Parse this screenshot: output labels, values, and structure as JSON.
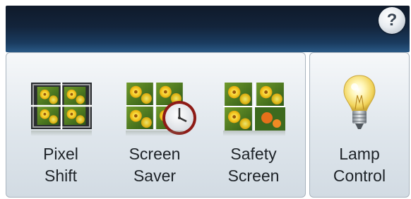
{
  "header": {
    "help_label": "?"
  },
  "items": [
    {
      "line1": "Pixel",
      "line2": "Shift",
      "icon": "pixel-shift-icon"
    },
    {
      "line1": "Screen",
      "line2": "Saver",
      "icon": "screen-saver-icon"
    },
    {
      "line1": "Safety",
      "line2": "Screen",
      "icon": "safety-screen-icon"
    },
    {
      "line1": "Lamp",
      "line2": "Control",
      "icon": "lightbulb-icon"
    }
  ],
  "colors": {
    "header_dark": "#13243b",
    "header_light": "#2a5a86",
    "panel_top": "#f6f8fa",
    "panel_bottom": "#d2dbe3",
    "label_text": "#1e2328"
  }
}
